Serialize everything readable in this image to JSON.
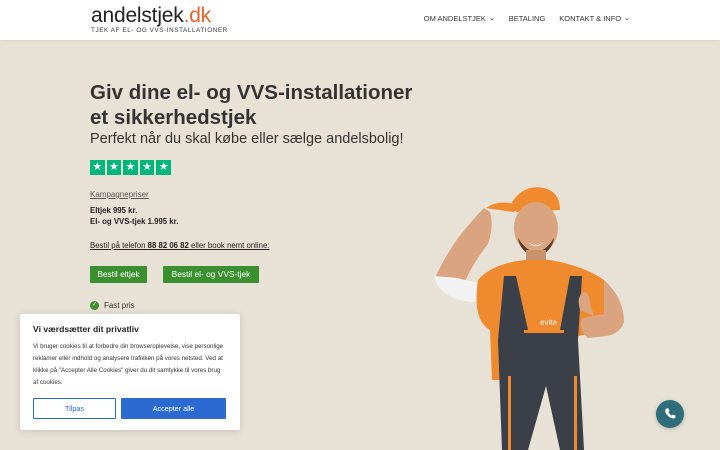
{
  "header": {
    "logo_main_a": "andelstjek",
    "logo_main_b": ".dk",
    "logo_tagline": "TJEK AF EL- OG VVS-INSTALLATIONER",
    "nav": [
      {
        "label": "OM ANDELSTJEK",
        "has_dropdown": true
      },
      {
        "label": "BETALING",
        "has_dropdown": false
      },
      {
        "label": "KONTAKT & INFO",
        "has_dropdown": true
      }
    ]
  },
  "hero": {
    "title": "Giv dine el- og VVS-installationer et sikkerhedstjek",
    "subtitle": "Perfekt når du skal købe eller sælge andelsbolig!",
    "rating_stars": 5,
    "campaign_label": "Kampagnepriser",
    "price_el": "Eltjek 995 kr.",
    "price_el_vvs": "El- og VVS-tjek 1.995 kr.",
    "order_prefix": "Bestil på telefon ",
    "order_phone": "88 82 06 82",
    "order_suffix": " eller book nemt online:",
    "button_eltjek": "Bestil eltjek",
    "button_el_vvs": "Bestil el- og VVS-tjek",
    "feature_1": "Fast pris"
  },
  "cookie": {
    "title": "Vi værdsætter dit privatliv",
    "text": "Vi bruger cookies til at forbedre din browseroplevelse, vise personlige reklamer eller indhold og analysere trafikken på vores netsted. Ved at klikke på \"Accepter Alle Cookies\" giver du dit samtykke til vores brug af cookies.",
    "customize_label": "Tilpas",
    "accept_label": "Accepter alle"
  },
  "worker_shirt_text": "evite",
  "colors": {
    "accent_orange": "#e8632b",
    "green_button": "#3a8f2e",
    "trustpilot_green": "#00b67a",
    "cookie_blue": "#2b6ad1",
    "phone_button": "#2e6e7b",
    "page_bg": "#e8e2d6"
  },
  "icons": {
    "check": "check-circle-icon",
    "chevron": "chevron-down-icon",
    "phone": "phone-icon",
    "star": "star-icon"
  }
}
